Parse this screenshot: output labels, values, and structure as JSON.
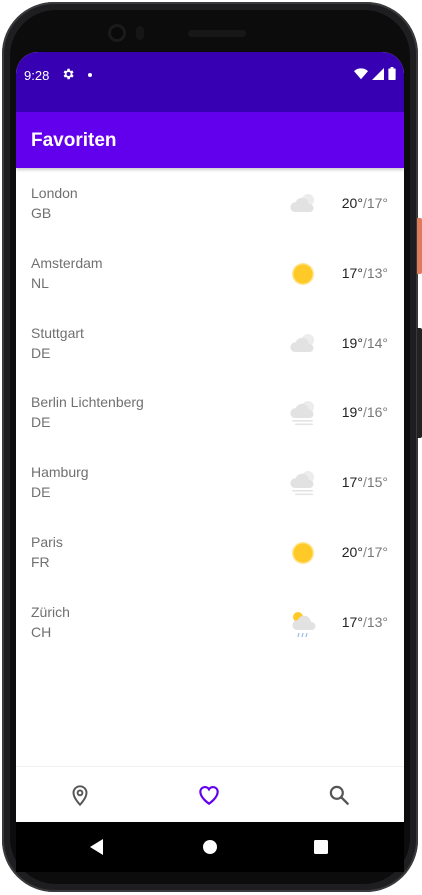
{
  "status_bar": {
    "time": "9:28"
  },
  "app_bar": {
    "title": "Favoriten"
  },
  "colors": {
    "status_bar": "#3700b3",
    "app_bar": "#6200ee",
    "accent": "#6200ee",
    "sun": "#ffc928"
  },
  "favorites": [
    {
      "city": "London",
      "country": "GB",
      "icon": "cloud-icon",
      "high": "20°",
      "low": "17°"
    },
    {
      "city": "Amsterdam",
      "country": "NL",
      "icon": "sun-icon",
      "high": "17°",
      "low": "13°"
    },
    {
      "city": "Stuttgart",
      "country": "DE",
      "icon": "cloud-icon",
      "high": "19°",
      "low": "14°"
    },
    {
      "city": "Berlin Lichtenberg",
      "country": "DE",
      "icon": "fog-icon",
      "high": "19°",
      "low": "16°"
    },
    {
      "city": "Hamburg",
      "country": "DE",
      "icon": "fog-icon",
      "high": "17°",
      "low": "15°"
    },
    {
      "city": "Paris",
      "country": "FR",
      "icon": "sun-icon",
      "high": "20°",
      "low": "17°"
    },
    {
      "city": "Zürich",
      "country": "CH",
      "icon": "sun-rain-cloud-icon",
      "high": "17°",
      "low": "13°"
    }
  ],
  "bottom_nav": {
    "items": [
      {
        "icon": "location-pin-icon",
        "active": false
      },
      {
        "icon": "heart-icon",
        "active": true
      },
      {
        "icon": "search-icon",
        "active": false
      }
    ]
  },
  "system_nav": {
    "buttons": [
      "back-icon",
      "home-icon",
      "recents-icon"
    ]
  }
}
